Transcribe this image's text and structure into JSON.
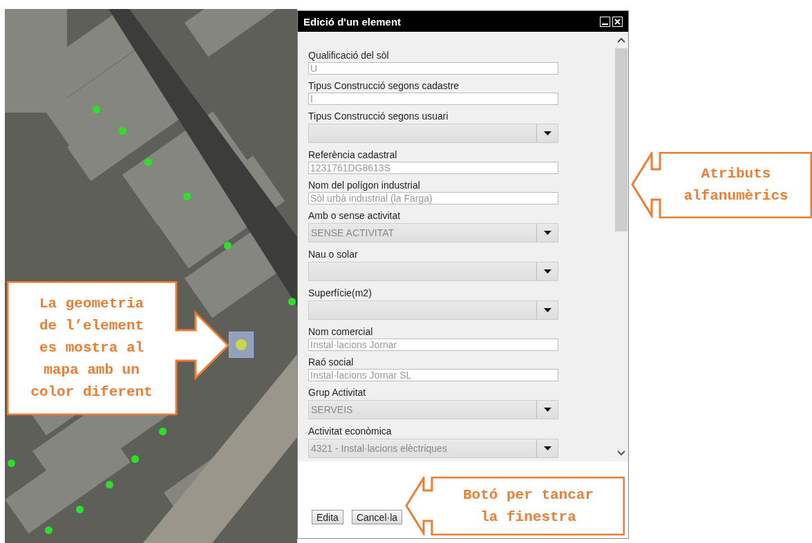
{
  "dialog": {
    "title": "Edició d'un element",
    "fields": [
      {
        "kind": "text",
        "label": "Qualificació del sòl",
        "value": "U"
      },
      {
        "kind": "text",
        "label": "Tipus Construcció segons cadastre",
        "value": "I"
      },
      {
        "kind": "select",
        "label": "Tipus Construcció segons usuari"
      },
      {
        "kind": "text",
        "label": "Referència cadastral",
        "value": "1231761DG8613S"
      },
      {
        "kind": "text",
        "label": "Nom del polígon industrial",
        "value": "Sòl urbà industrial (la Farga)"
      },
      {
        "kind": "select",
        "label": "Amb o sense activitat",
        "value": "SENSE ACTIVITAT"
      },
      {
        "kind": "select",
        "label": "Nau o solar"
      },
      {
        "kind": "select",
        "label": "Superfície(m2)"
      },
      {
        "kind": "text",
        "label": "Nom comercial",
        "value": "Instal·lacions Jornar"
      },
      {
        "kind": "text",
        "label": "Raó social",
        "value": "Instal·lacions Jornar SL"
      },
      {
        "kind": "select",
        "label": "Grup Activitat",
        "value": "SERVEIS"
      },
      {
        "kind": "select",
        "label": "Activitat econòmica",
        "value": "4321 - Instal·lacions elèctriques"
      }
    ],
    "buttons": [
      "Edita",
      "Cancel·la"
    ]
  },
  "callouts": [
    {
      "kind": "right",
      "text": "La geometria de l’element es mostra al mapa amb un color diferent"
    },
    {
      "kind": "left",
      "text": "Atributs alfanumèrics"
    },
    {
      "kind": "left",
      "text": "Botó per tancar la finestra"
    }
  ]
}
